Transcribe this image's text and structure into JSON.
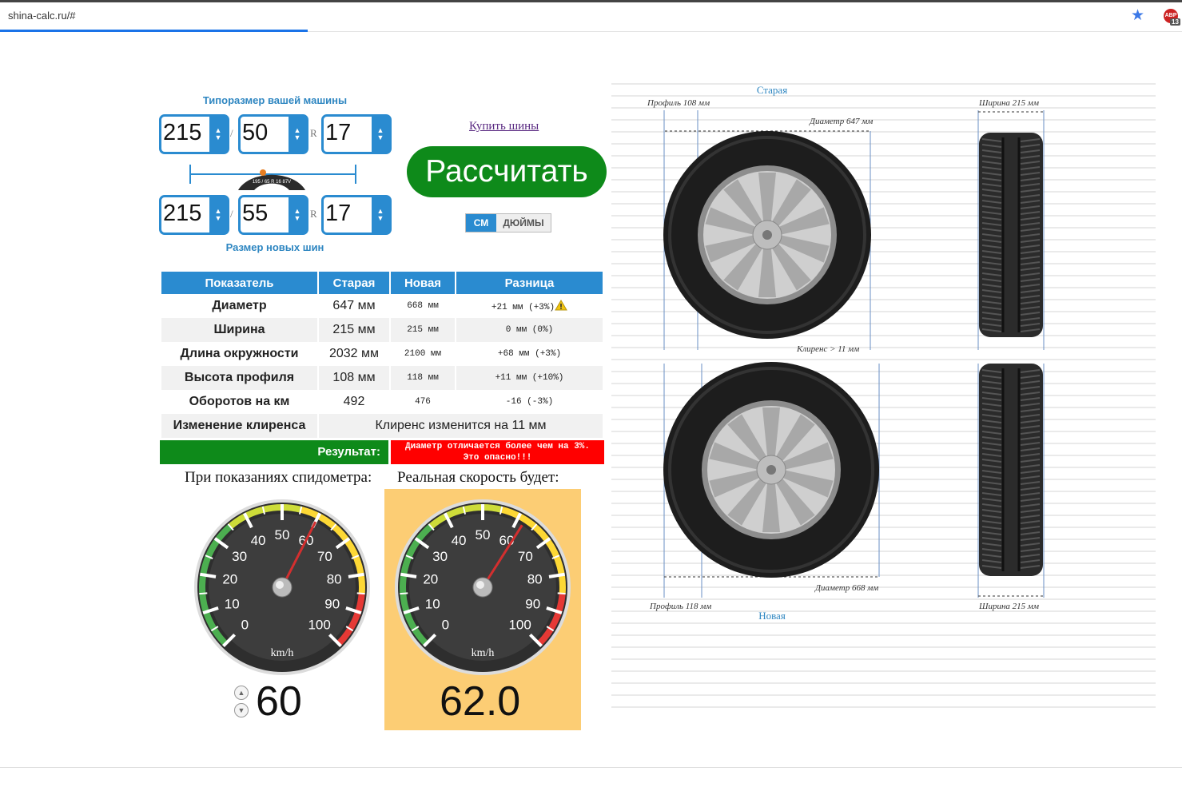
{
  "browser": {
    "url": "shina-calc.ru/#",
    "ext_badge": "13",
    "ext_label": "ABP"
  },
  "form": {
    "old_caption": "Типоразмер вашей машины",
    "new_caption": "Размер новых шин",
    "old": {
      "width": "215",
      "profile": "50",
      "radius": "17"
    },
    "new": {
      "width": "215",
      "profile": "55",
      "radius": "17"
    },
    "slash": "/",
    "r": "R",
    "tire_logo_text": "195 / 65 R 16 87V",
    "buy_link": "Купить шины",
    "calc_button": "Рассчитать",
    "unit_cm": "СМ",
    "unit_in": "ДЮЙМЫ"
  },
  "table": {
    "headers": [
      "Показатель",
      "Старая",
      "Новая",
      "Разница"
    ],
    "rows": [
      {
        "name": "Диаметр",
        "old": "647 мм",
        "new": "668 мм",
        "diff": "+21 мм (+3%)",
        "warn": true
      },
      {
        "name": "Ширина",
        "old": "215 мм",
        "new": "215 мм",
        "diff": "0 мм (0%)"
      },
      {
        "name": "Длина окружности",
        "old": "2032 мм",
        "new": "2100 мм",
        "diff": "+68 мм (+3%)"
      },
      {
        "name": "Высота профиля",
        "old": "108 мм",
        "new": "118 мм",
        "diff": "+11 мм (+10%)"
      },
      {
        "name": "Оборотов на км",
        "old": "492",
        "new": "476",
        "diff": "-16 (-3%)"
      }
    ],
    "clearance_label": "Изменение клиренса",
    "clearance_value": "Клиренс изменится на 11 мм",
    "result_label": "Результат:",
    "result_msg_line1": "Диаметр отличается более чем на 3%.",
    "result_msg_line2": "Это опасно!!!"
  },
  "speed": {
    "left_label": "При показаниях спидометра:",
    "right_label": "Реальная скорость будет:",
    "input_value": "60",
    "real_value": "62.0",
    "unit": "km/h",
    "ticks": [
      "0",
      "10",
      "20",
      "30",
      "40",
      "50",
      "60",
      "70",
      "80",
      "90",
      "100"
    ],
    "left_needle_kmh": 60,
    "right_needle_kmh": 62
  },
  "diagram": {
    "old_title": "Старая",
    "new_title": "Новая",
    "old_profile": "Профиль 108 мм",
    "old_width": "Ширина 215 мм",
    "old_diameter": "Диаметр 647 мм",
    "clearance": "Клиренс > 11 мм",
    "new_profile": "Профиль 118 мм",
    "new_width": "Ширина 215 мм",
    "new_diameter": "Диаметр 668 мм"
  }
}
